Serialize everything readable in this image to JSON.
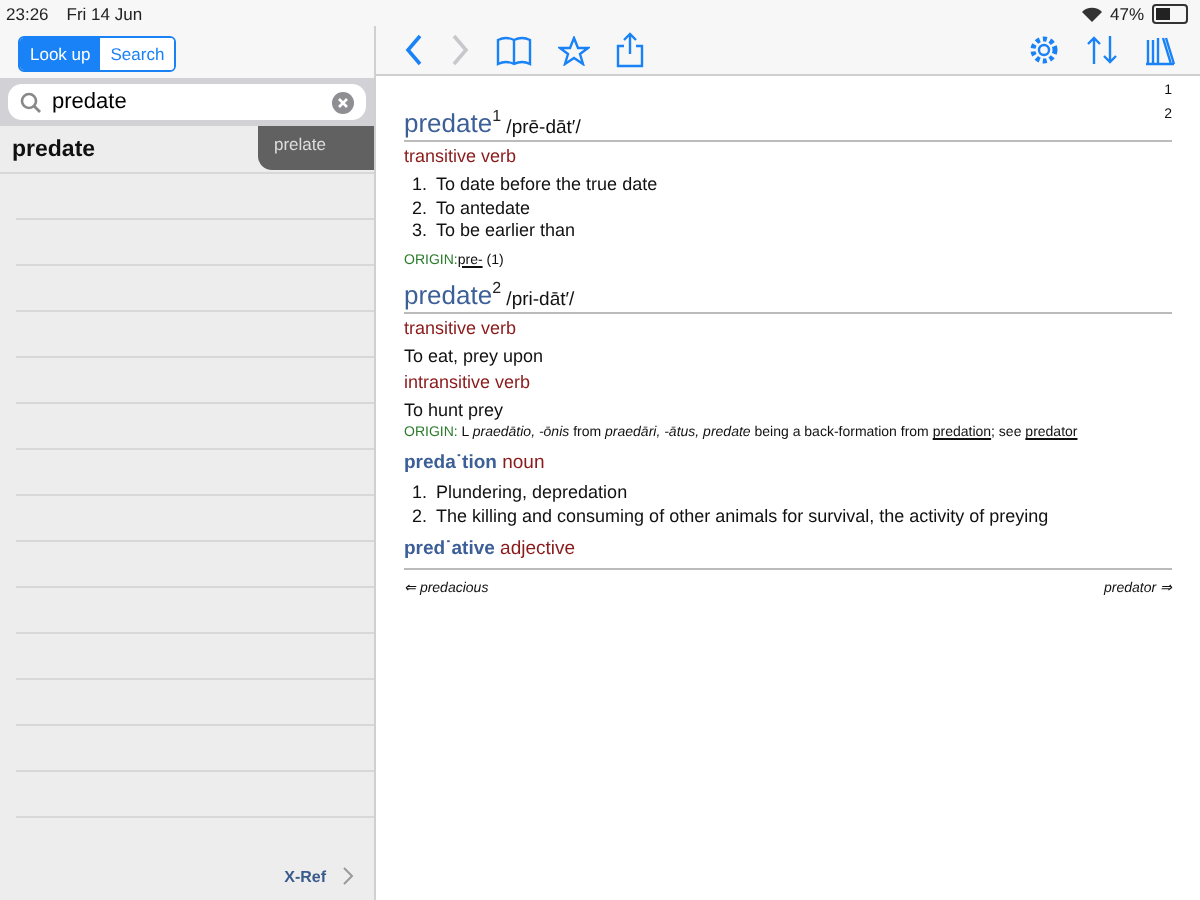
{
  "status_bar": {
    "time": "23:26",
    "date": "Fri 14 Jun",
    "battery": "47%"
  },
  "sidebar": {
    "segments": [
      {
        "label": "Look up",
        "selected": true
      },
      {
        "label": "Search",
        "selected": false
      }
    ],
    "search": {
      "value": "predate"
    },
    "results": [
      {
        "label": "predate",
        "selected": false
      }
    ],
    "suggestion": "prelate",
    "footer_link": "X-Ref"
  },
  "toolbar": {
    "nav": [
      {
        "kind": "back",
        "disabled": false
      },
      {
        "kind": "forward",
        "disabled": true
      }
    ]
  },
  "entry": {
    "page_marks": [
      "1",
      "2"
    ],
    "blocks": [
      {
        "kind": "headword",
        "word": "predate",
        "sup": "1",
        "pron": "/prē-dāt′/"
      },
      {
        "kind": "pos",
        "text": "transitive verb"
      },
      {
        "kind": "list",
        "items": [
          {
            "number": "1.",
            "text": "To date before the true date"
          },
          {
            "number": "2.",
            "text": "To antedate"
          },
          {
            "number": "3.",
            "text": "To be earlier than"
          }
        ]
      },
      {
        "kind": "origin",
        "label": "ORIGIN:",
        "parts": [
          {
            "kind": "link",
            "text": "pre-"
          },
          {
            "kind": "plain",
            "text": " (1)"
          }
        ]
      },
      {
        "kind": "headword",
        "word": "predate",
        "sup": "2",
        "pron": "/pri-dāt′/"
      },
      {
        "kind": "pos",
        "text": "transitive verb"
      },
      {
        "kind": "definition",
        "text": "To eat, prey upon"
      },
      {
        "kind": "pos",
        "text": "intransitive verb"
      },
      {
        "kind": "definition",
        "text": "To hunt prey"
      },
      {
        "kind": "origin",
        "label": "ORIGIN:",
        "parts": [
          {
            "kind": "plain",
            "text": " L *praedātio, -ōnis* from *praedāri, -ātus, predate* being a back-formation from "
          },
          {
            "kind": "link",
            "text": "predation"
          },
          {
            "kind": "plain",
            "text": "; see "
          },
          {
            "kind": "link",
            "text": "predator"
          }
        ]
      },
      {
        "kind": "derived",
        "word": "preda˙tion",
        "pos": "noun"
      },
      {
        "kind": "list",
        "items": [
          {
            "number": "1.",
            "text": "Plundering, depredation"
          },
          {
            "number": "2.",
            "text": "The killing and consuming of other animals for survival, the activity of preying"
          }
        ]
      },
      {
        "kind": "derived",
        "word": "pred˙ative",
        "pos": "adjective"
      }
    ],
    "prev": "⇐ predacious",
    "next": "predator ⇒"
  }
}
